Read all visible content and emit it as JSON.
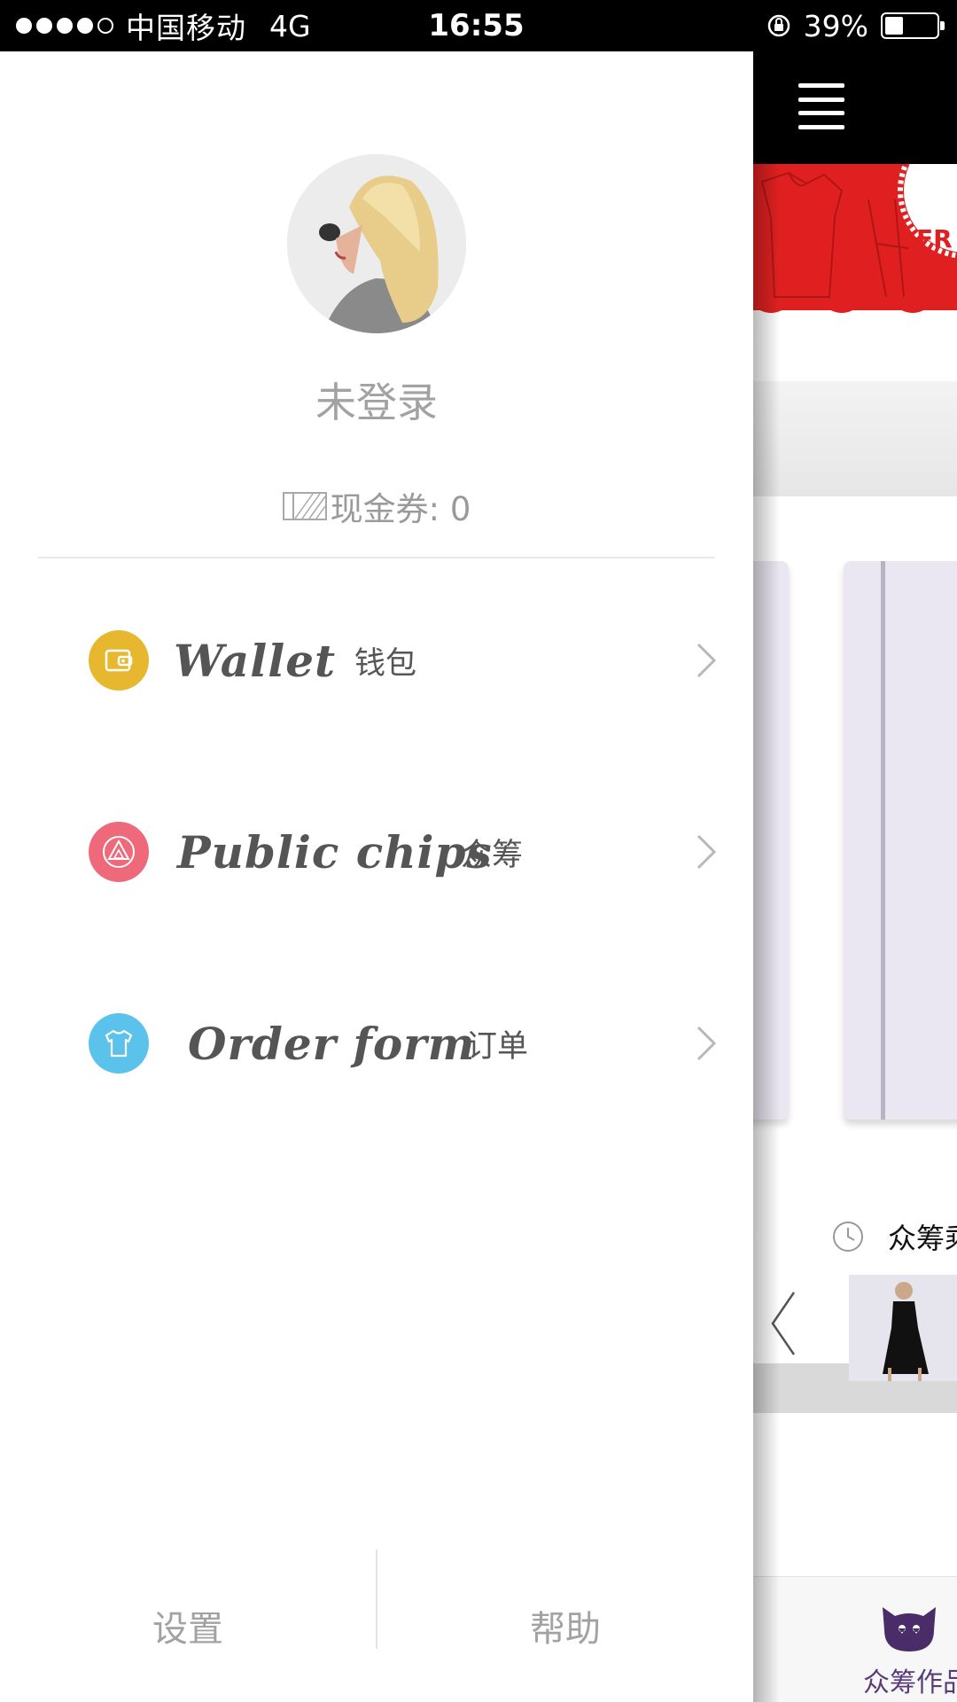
{
  "status_bar": {
    "carrier": "中国移动",
    "network": "4G",
    "time": "16:55",
    "battery_percent": "39%",
    "battery_level": 0.39
  },
  "drawer": {
    "login_status": "未登录",
    "coupon_label": "现金券: 0",
    "menu": [
      {
        "en": "Wallet",
        "cn": "钱包",
        "icon": "wallet-icon",
        "color": "#E8B730"
      },
      {
        "en": "Public chips",
        "cn": "众筹",
        "icon": "triangles-icon",
        "color": "#EE6A7B"
      },
      {
        "en": "Order form",
        "cn": "订单",
        "icon": "tshirt-icon",
        "color": "#5BC2EC"
      }
    ],
    "bottom": {
      "settings": "设置",
      "help": "帮助"
    }
  },
  "main": {
    "banner_text": "FR",
    "crowd_text": "众筹乘",
    "nav_label": "众筹作品"
  },
  "colors": {
    "accent_red": "#E02020",
    "text_gray": "#A2A2A2",
    "nav_purple": "#5A3B7A"
  }
}
